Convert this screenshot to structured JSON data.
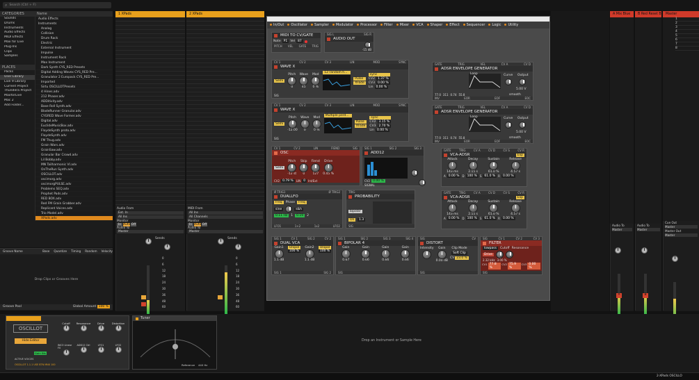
{
  "browser": {
    "search_placeholder": "Search (Ctrl + F)",
    "categories_header": "CATEGORIES",
    "name_header": "Name",
    "categories": [
      "Sounds",
      "Drums",
      "Instruments",
      "Audio Effects",
      "MIDI Effects",
      "Max for Live",
      "Plug-Ins",
      "Clips",
      "Samples"
    ],
    "places_header": "PLACES",
    "places": [
      "Packs",
      "User Library",
      "Live 9 Library",
      "Current Project",
      "Thundera Project",
      "MaxforLive",
      "Mac 2",
      "Add Folder..."
    ],
    "folders": [
      "Audio Effects",
      "Instruments",
      "Analog",
      "Collision",
      "Drum Rack",
      "Electric",
      "External Instrument",
      "Impulse",
      "Instrument Rack",
      "Max Instrument"
    ],
    "files": [
      "Dark Synth CYS_RED Presets",
      "Digital Adding Wavex CYS_RED Pre...",
      "Granulator 2 Europack CYS_RED Pre...",
      "Imported",
      "Sirtu OSCILLOTPresets",
      "4 Hines.adv",
      "212 Phaser.adv",
      "ADDitivity.adv",
      "Base Roll Synth.adv",
      "BladeRunner Granular.adv",
      "CYGRED Wave Former.adv",
      "Digital.adv",
      "EuclideMusicBox.adv",
      "FloydeSynth proto.adv",
      "FloydeSynth.adv",
      "FM Thug.adv",
      "Grain Wars.adv",
      "GrainSaw.adv",
      "Granular Bar Crowd.adv",
      "Lil Bobby.adv",
      "MN Tailharmonic VI.adv",
      "OnTheRun Synth.adv",
      "OSCILLOT.adv",
      "oscimorg.adv",
      "oscimorgPULSE.adv",
      "Problems SEQ.adv",
      "Prophet Pads.adv",
      "RED BOX.adv",
      "Red FM Grain Grabber.adv",
      "Replicant Voices.adv",
      "Trio Model.adv",
      "XPads.adv"
    ],
    "groove_header": "Groove Name",
    "groove_cols": [
      "Base",
      "Quantize",
      "Timing",
      "Random",
      "Velocity"
    ],
    "groove_drop": "Drop Clips or Grooves Here",
    "groove_pool": "Groove Pool",
    "global_amount_label": "Global Amount",
    "global_amount_value": "100 %"
  },
  "tracks": [
    {
      "name": "1 XPads",
      "color": "#e8a01c"
    },
    {
      "name": "2 XPads",
      "color": "#e8a01c"
    },
    {
      "name": "A Mix Blue",
      "color": "#d03a2a"
    },
    {
      "name": "B Red Reset Bri",
      "color": "#d03a2a"
    },
    {
      "name": "Master",
      "color": "#d03a2a"
    }
  ],
  "scene_numbers": [
    "1",
    "2",
    "3",
    "4",
    "5",
    "6",
    "7",
    "8"
  ],
  "io": {
    "audio_from": "Audio From",
    "ext_in": "Ext. In",
    "midi_from": "MIDI From",
    "all_ins": "All Ins",
    "all_channels": "All Channels",
    "monitor": "Monitor",
    "in_label": "In",
    "auto_label": "Auto",
    "off_label": "Off",
    "audio_to": "Audio To",
    "master": "Master",
    "sends": "Sends",
    "cue_out": "Cue Out",
    "master_out": "Master Out"
  },
  "meter_scale": [
    "0",
    "6",
    "12",
    "18",
    "24",
    "30",
    "36",
    "48",
    "60"
  ],
  "plugin": {
    "tabs": [
      "In/Out",
      "Oscillator",
      "Sampler",
      "Modulator",
      "Processor",
      "Filter",
      "Mixer",
      "VCA",
      "Shaper",
      "Effect",
      "Sequencer",
      "Logic",
      "Utility"
    ],
    "midi": {
      "title": "MIDI TO CV/GATE",
      "note_label": "Note",
      "note_val": "P1",
      "vel_label": "Vel",
      "vel_val": "87",
      "ports": [
        "PITCH",
        "VEL",
        "GATE",
        "TRIG"
      ]
    },
    "audio_out": {
      "title": "AUDIO OUT",
      "sig_l": "SIG L",
      "sig_r": "SIG R",
      "db": "-15 dB"
    },
    "wave1": {
      "title": "WAVE X",
      "ports": [
        "CV 1",
        "CV 2",
        "CV 3",
        "LIN",
        "MOD",
        "SYNC"
      ],
      "semi": "Semi",
      "k1": "Pitch",
      "k2": "Wave",
      "k3": "Mod",
      "v1": "0",
      "v2": "45",
      "v3": "0 %",
      "preset": "12 random h...",
      "sync": "sync",
      "wave_label": "Pulse",
      "xfade": "XFade",
      "cv1": "CV2",
      "cv1v": "1.37 %",
      "cv2": "CV3",
      "cv2v": "0.00 %",
      "lin": "Lin",
      "linv": "0.00 %",
      "sig": "SIG"
    },
    "wave2": {
      "title": "WAVE X",
      "ports": [
        "CV 1",
        "CV 2",
        "CV 3",
        "LIN",
        "MOD",
        "SYNC"
      ],
      "semi": "Semi",
      "k1": "Pitch",
      "k2": "Wave",
      "k3": "Mod",
      "v1": "-12.00",
      "v2": "0",
      "v3": "0 %",
      "preset": "Multiple perd...",
      "sync": "sync",
      "wave_label": "Pulse",
      "xfade": "XFade",
      "cv1": "CV2",
      "cv1v": "3.15 %",
      "cv2": "CV3",
      "cv2v": "2.70 %",
      "lin": "Lin",
      "linv": "0.00 %",
      "sig": "SIG"
    },
    "adsr1": {
      "title": "ADSR ENVELOPE GENERATOR",
      "ports": [
        "GATE",
        "TRIG",
        "VEL",
        "CV A",
        "CV D"
      ],
      "loop": "Loop",
      "curve": "Curve",
      "output": "Output",
      "out_val": "5.00 V",
      "vals": [
        "77.0",
        "311",
        "0.74",
        "55.8"
      ],
      "smooth": "smooth",
      "bottom": [
        "INV",
        "EOR",
        "EOF",
        "EOC"
      ]
    },
    "adsr2": {
      "title": "ADSR ENVELOPE GENERATOR",
      "ports": [
        "GATE",
        "TRIG",
        "VEL",
        "CV A",
        "CV D"
      ],
      "loop": "Loop",
      "curve": "Curve",
      "output": "Output",
      "out_val": "5.00 V",
      "vals": [
        "77.0",
        "311",
        "0.74",
        "55.8"
      ],
      "smooth": "smooth",
      "bottom": [
        "INV",
        "EOR",
        "EOF",
        "EOC"
      ]
    },
    "osc": {
      "title": "OSC",
      "ports": [
        "CV 1",
        "CV 2",
        "LIN",
        "FIEND",
        "SIG"
      ],
      "semi": "Semi",
      "k": [
        "Pitch",
        "Skip",
        "Fiend",
        "Drive"
      ],
      "v": [
        "-12 st",
        "0",
        "127",
        "0.45 %"
      ],
      "cv2": "CV2",
      "cv2v": "0.79 %",
      "lin": "LIN",
      "linv": "0",
      "int": "Int/Ext",
      "sig": "SIG"
    },
    "add12": {
      "title": "ADD12",
      "ports": [
        "SIG 1",
        "SIG 2",
        "SIG 3"
      ],
      "cv2": "CV2",
      "cv2v": "0.00 %",
      "signal": "SIGNAL"
    },
    "vca1": {
      "title": "VCA-ADSR",
      "ports": [
        "GATE",
        "TRIG",
        "CV A",
        "CV D",
        "CV S",
        "CV R"
      ],
      "k": [
        "Attack",
        "Decay",
        "Sustain",
        "Release"
      ],
      "v": [
        "143 ms",
        "2.15 s",
        "61.0 %",
        "4.57 s"
      ],
      "exp": "Exp",
      "mods": [
        "A",
        "0.00 %",
        "D",
        "100 %",
        "S",
        "61.0 %",
        "R",
        "0.00 %"
      ]
    },
    "vca2": {
      "title": "VCA-ADSR",
      "ports": [
        "GATE",
        "TRIG",
        "CV A",
        "CV D",
        "CV S",
        "CV R"
      ],
      "k": [
        "Attack",
        "Decay",
        "Sustain",
        "Release"
      ],
      "v": [
        "143 ms",
        "2.15 s",
        "61.0 %",
        "4.57 s"
      ],
      "exp": "Exp",
      "mods": [
        "A",
        "0.00 %",
        "D",
        "100 %",
        "S",
        "61.0 %",
        "R",
        "0.00 %"
      ]
    },
    "duallfo": {
      "title": "DUALLFO",
      "ports": [
        "Ø TRIG1",
        "Ø TRIG2"
      ],
      "freq": "Freq",
      "phase": "Phase",
      "shape1": "sine",
      "shape2": "s&h",
      "hz": "0.11 Hz",
      "val2": "0.19",
      "num1": "1",
      "num2": "2",
      "bottom": [
        "LFO1",
        "1+2",
        "1x2",
        "LFO2"
      ]
    },
    "prob": {
      "title": "PROBABILITY",
      "ports": [
        "TRIG"
      ],
      "bipolar": "bipolar",
      "on": "On",
      "val": "1.3",
      "bottom": [
        "SIG"
      ]
    },
    "dualvca": {
      "title": "DUAL VCA",
      "ports": [
        "SIG 1",
        "CV 1",
        "SIG 2",
        "CV 2"
      ],
      "k": [
        "Gain1",
        "Gain2"
      ],
      "v": [
        "1.1 dB",
        "1.1 dB"
      ],
      "unipol": "Unipol",
      "cv1": "CV1",
      "cv2": "CV2",
      "pct1": "100 %",
      "pct2": "100 %",
      "bottom": [
        "SIG 1",
        "SIG 2"
      ]
    },
    "bipolar": {
      "title": "BIPOLAR 4",
      "ports": [
        "SIG 1",
        "SIG 2",
        "SIG 3",
        "SIG 4"
      ],
      "k": [
        "Gain",
        "Gain",
        "Gain",
        "Gain"
      ],
      "v": [
        "0.67",
        "0.66",
        "0.66",
        "0.66"
      ],
      "bottom": [
        "SIG"
      ]
    },
    "distort": {
      "title": "DISTORT",
      "ports": [
        "SIG",
        "CV"
      ],
      "intensity": "Intensity",
      "gain": "Gain",
      "clip": "Clip Mode",
      "clipval": "Soft Clip",
      "gainv": "0.00 dB",
      "cv": "CV",
      "cvv": "23.0 %",
      "bottom": [
        "SIG"
      ]
    },
    "filter": {
      "title": "FILTER",
      "ports": [
        "SIG",
        "CV 1",
        "CV 2",
        "CV 3"
      ],
      "mode": "lowpass",
      "cutoff": "Cutoff",
      "reso": "Resonance",
      "drive": "Drive",
      "cutv": "2.32 kHz",
      "resv": "3.00 %",
      "cv1": "CV1",
      "cv1v": "77.8 %",
      "cv2": "CV2",
      "cv2v": "75.9 %",
      "cv3": "CV3",
      "cv3v": "0.00 %",
      "bottom": [
        "SIG"
      ]
    }
  },
  "devices": {
    "oscillot": {
      "title": "OSCILLOT",
      "hide": "Hide Editor",
      "knobs": [
        "Cutoff",
        "Resonance",
        "Drive",
        "Distortion"
      ],
      "knobs2": [
        "INCO Linear F0",
        "ADD12 Ctrl",
        "LFO1",
        "LFO2"
      ],
      "footer": "OSCILLOT 1.1.1 USE  BTN  MNX 100",
      "active": "ACTIVE VOICES",
      "gain": "Gain INs"
    },
    "tuner": {
      "title": "Tuner",
      "reference": "Reference",
      "hz": "440 Hz"
    },
    "drop": "Drop an Instrument or Sample Here",
    "status": "2-XPads OSCILLO"
  }
}
